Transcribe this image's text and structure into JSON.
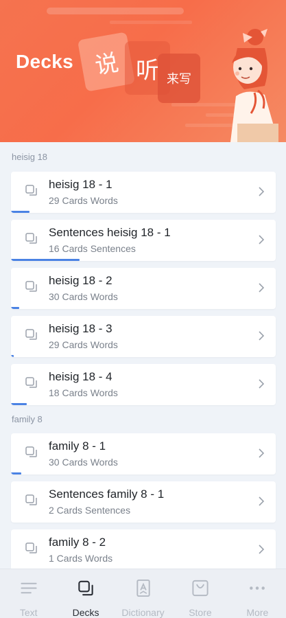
{
  "header": {
    "title": "Decks",
    "tile_chars": [
      "说",
      "听",
      "来写"
    ]
  },
  "sections": [
    {
      "label": "heisig 18",
      "decks": [
        {
          "title": "heisig 18 - 1",
          "subtitle": "29 Cards Words",
          "progress": 0.07
        },
        {
          "title": "Sentences heisig 18 - 1",
          "subtitle": "16 Cards Sentences",
          "progress": 0.26
        },
        {
          "title": "heisig 18 - 2",
          "subtitle": "30 Cards Words",
          "progress": 0.03
        },
        {
          "title": "heisig 18 - 3",
          "subtitle": "29 Cards Words",
          "progress": 0.01
        },
        {
          "title": "heisig 18 - 4",
          "subtitle": "18 Cards Words",
          "progress": 0.06
        }
      ]
    },
    {
      "label": "family 8",
      "decks": [
        {
          "title": "family 8 - 1",
          "subtitle": "30 Cards Words",
          "progress": 0.04
        },
        {
          "title": "Sentences family 8 - 1",
          "subtitle": "2 Cards Sentences",
          "progress": 0
        },
        {
          "title": "family 8 - 2",
          "subtitle": "1 Cards Words",
          "progress": 0
        }
      ]
    }
  ],
  "nav": {
    "items": [
      {
        "label": "Text",
        "icon": "text-lines-icon",
        "active": false
      },
      {
        "label": "Decks",
        "icon": "decks-icon",
        "active": true
      },
      {
        "label": "Dictionary",
        "icon": "dictionary-icon",
        "active": false
      },
      {
        "label": "Store",
        "icon": "store-icon",
        "active": false
      },
      {
        "label": "More",
        "icon": "more-dots-icon",
        "active": false
      }
    ]
  },
  "colors": {
    "header": "#f5734f",
    "progress": "#4a82e4",
    "background": "#eff3f8"
  }
}
